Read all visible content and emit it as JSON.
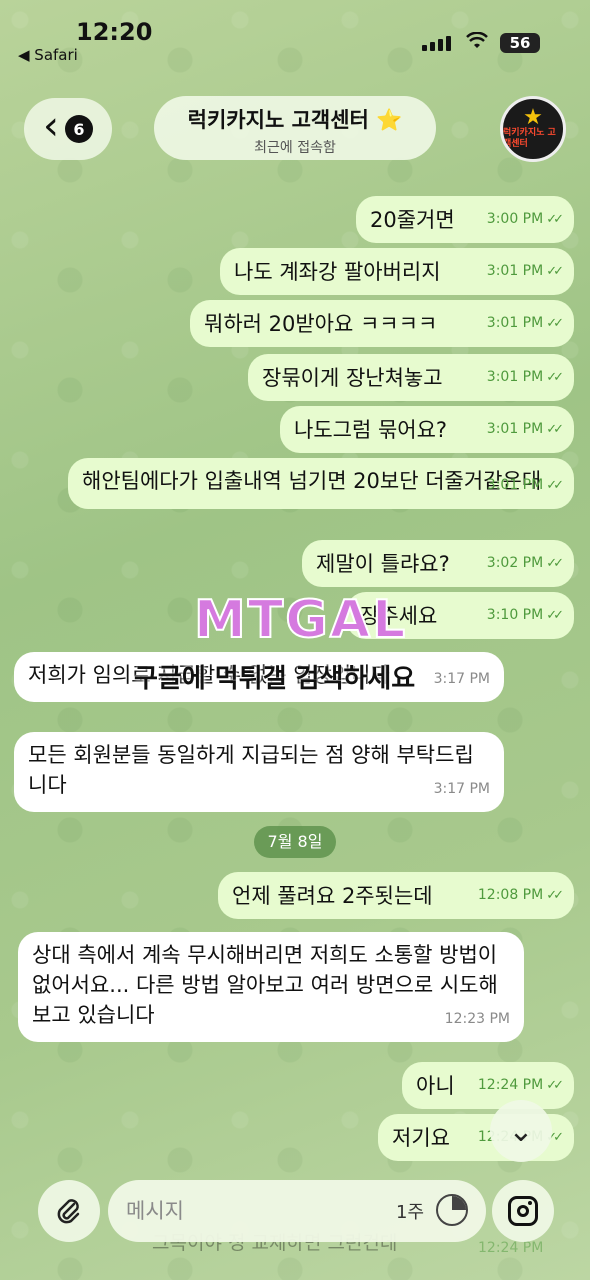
{
  "status_bar": {
    "time": "12:20",
    "back_app": "◀ Safari",
    "battery": "56"
  },
  "header": {
    "back_badge": "6",
    "title": "럭키카지노 고객센터 ⭐",
    "subtitle": "최근에 접속함",
    "avatar_text": "럭키카지노 고객센터"
  },
  "messages": [
    {
      "dir": "out",
      "text": "20줄거면",
      "time": "3:00 PM"
    },
    {
      "dir": "out",
      "text": "나도 계좌강 팔아버리지",
      "time": "3:01 PM"
    },
    {
      "dir": "out",
      "text": "뭐하러 20받아요 ㅋㅋㅋㅋ",
      "time": "3:01 PM"
    },
    {
      "dir": "out",
      "text": "장묶이게 장난쳐놓고",
      "time": "3:01 PM"
    },
    {
      "dir": "out",
      "text": "나도그럼 묶어요?",
      "time": "3:01 PM"
    },
    {
      "dir": "out",
      "text": "해안팀에다가 입출내역 넘기면 20보단 더줄거같은대",
      "time": "3:01 PM"
    },
    {
      "dir": "out",
      "text": "제말이 틀랴요?",
      "time": "3:02 PM"
    },
    {
      "dir": "out",
      "text": "장주세요",
      "time": "3:10 PM"
    },
    {
      "dir": "in",
      "text": "저희가 임의로 지급할 수 없는 입장입니다",
      "time": "3:17 PM"
    },
    {
      "dir": "in",
      "text": "모든 회원분들 동일하게 지급되는 점 양해 부탁드립니다",
      "time": "3:17 PM"
    },
    {
      "dir": "out",
      "text": "언제 풀려요 2주됫는데",
      "time": "12:08 PM"
    },
    {
      "dir": "in",
      "text": "상대 측에서 계속 무시해버리면 저희도 소통할 방법이 없어서요... 다른 방법 알아보고 여러 방면으로 시도해보고 있습니다",
      "time": "12:23 PM"
    },
    {
      "dir": "out",
      "text": "아니",
      "time": "12:24 PM"
    },
    {
      "dir": "out",
      "text": "저기요",
      "time": "12:24 PM"
    }
  ],
  "date_separator": "7월 8일",
  "watermark": {
    "logo": "MTGAL",
    "text": "구글에 먹튀갤 검색하세요"
  },
  "composer": {
    "placeholder": "메시지",
    "timer_label": "1주"
  },
  "peek": {
    "text": "그목이야 정 교제하면 그런건데",
    "time": "12:24 PM"
  }
}
